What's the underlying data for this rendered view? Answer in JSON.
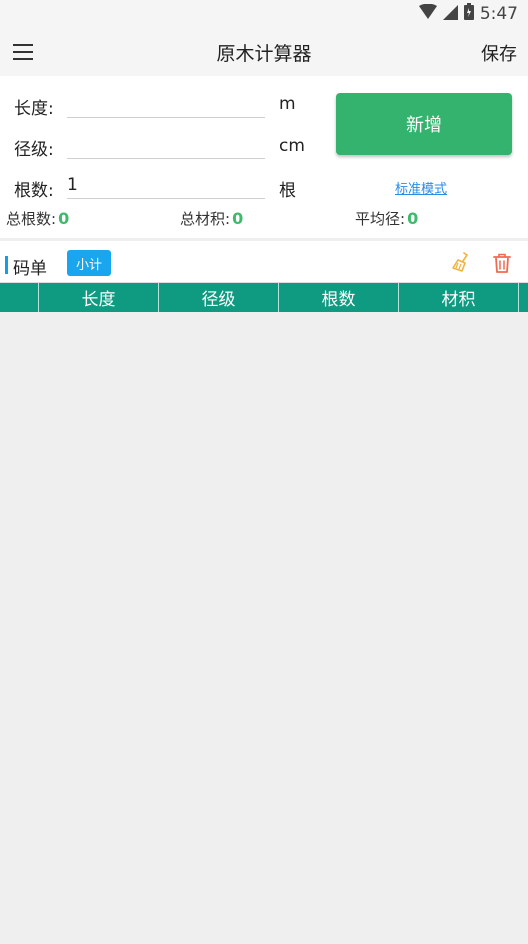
{
  "status_bar": {
    "time": "5:47"
  },
  "app_bar": {
    "title": "原木计算器",
    "save_label": "保存"
  },
  "form": {
    "length": {
      "label": "长度:",
      "value": "",
      "unit": "m"
    },
    "diameter": {
      "label": "径级:",
      "value": "",
      "unit": "cm"
    },
    "count": {
      "label": "根数:",
      "value": "1",
      "unit": "根"
    },
    "add_button": "新增",
    "standard_mode_link": "标准模式"
  },
  "stats": {
    "total_count_label": "总根数:",
    "total_count": "0",
    "total_volume_label": "总材积:",
    "total_volume": "0",
    "avg_diameter_label": "平均径:",
    "avg_diameter": "0"
  },
  "sheet": {
    "title": "码单",
    "subtotal_button": "小计",
    "columns": [
      "",
      "长度",
      "径级",
      "根数",
      "材积"
    ],
    "rows": []
  },
  "colors": {
    "accent_green": "#34b36e",
    "header_teal": "#0e9b82",
    "link_blue": "#2b8be6",
    "subtotal_blue": "#1aa6ee"
  }
}
